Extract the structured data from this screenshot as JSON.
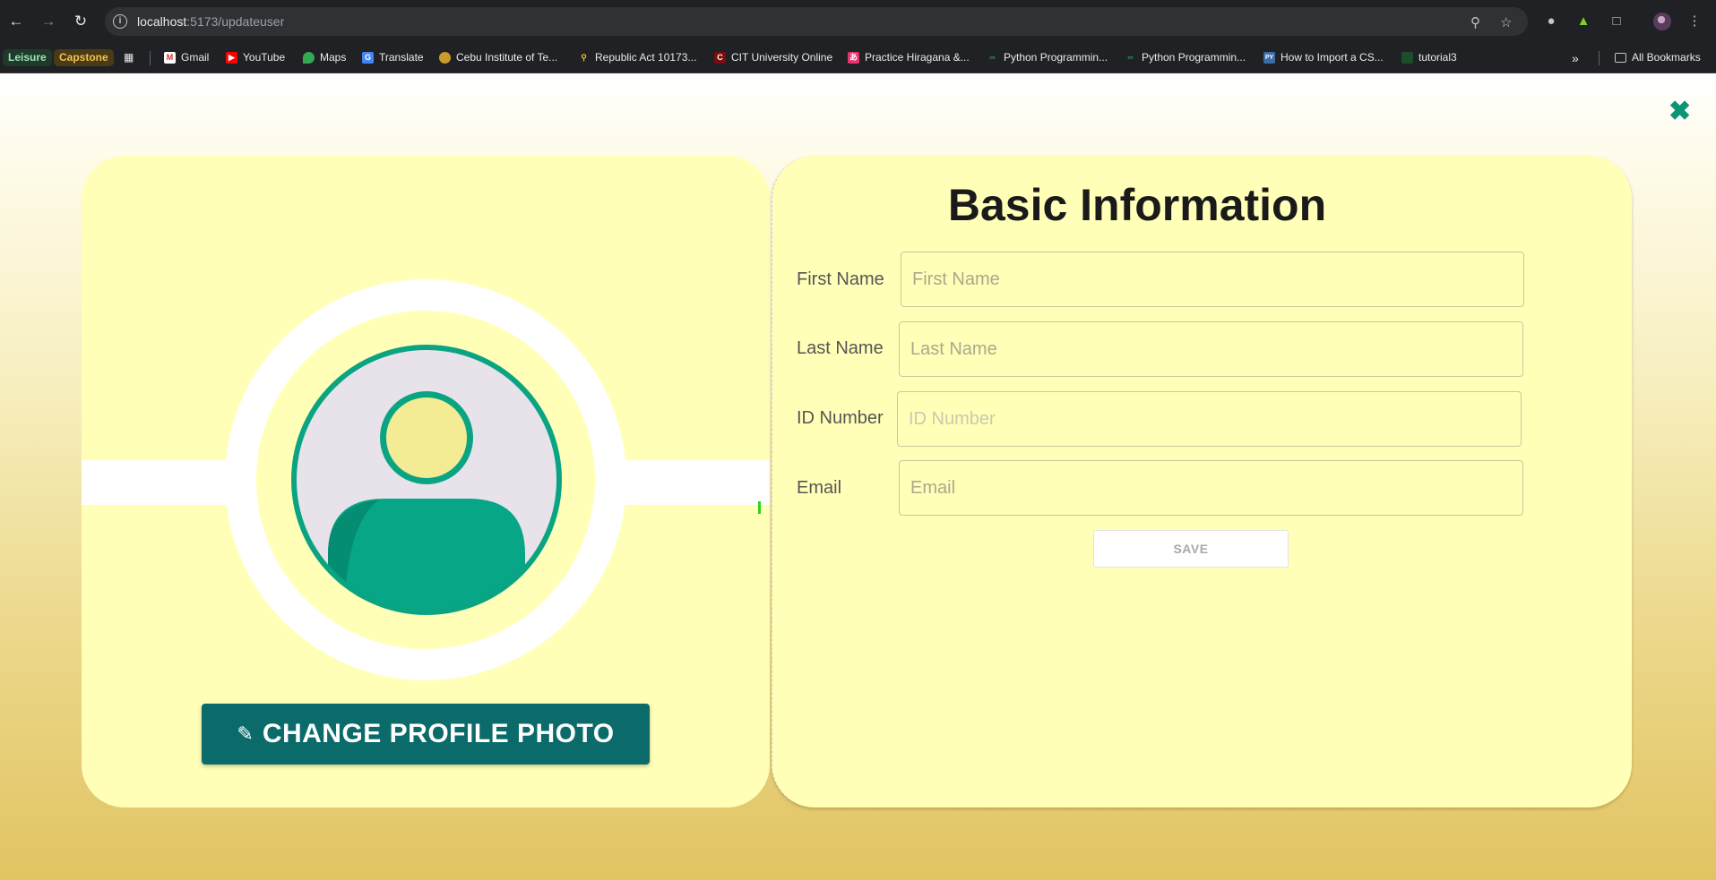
{
  "browser": {
    "url_host": "localhost",
    "url_path": ":5173/updateuser",
    "bookmarks": [
      {
        "label": "Leisure",
        "color": "#9ae6b4"
      },
      {
        "label": "Capstone",
        "color": "#f2c14e"
      },
      {
        "label": "Gmail",
        "icon": "gmail-icon"
      },
      {
        "label": "YouTube",
        "icon": "youtube-icon"
      },
      {
        "label": "Maps",
        "icon": "maps-icon"
      },
      {
        "label": "Translate",
        "icon": "translate-icon"
      },
      {
        "label": "Cebu Institute of Te...",
        "icon": "cit-icon"
      },
      {
        "label": "Republic Act 10173...",
        "icon": "pin-icon"
      },
      {
        "label": "CIT University Online",
        "icon": "cit-u-icon"
      },
      {
        "label": "Practice Hiragana &...",
        "icon": "hiragana-icon"
      },
      {
        "label": "Python Programmin...",
        "icon": "gfg-icon"
      },
      {
        "label": "Python Programmin...",
        "icon": "gfg-icon"
      },
      {
        "label": "How to Import a CS...",
        "icon": "py-icon"
      },
      {
        "label": "tutorial3",
        "icon": "tutorial-icon"
      }
    ],
    "all_bookmarks": "All Bookmarks"
  },
  "page": {
    "close_symbol": "✖",
    "profile": {
      "change_photo_label": "CHANGE PROFILE PHOTO",
      "avatar_colors": {
        "ring": "#0ba483",
        "face": "#f3ec95",
        "body": "#07a686",
        "bg": "#e8e3eb"
      }
    },
    "form": {
      "title": "Basic Information",
      "fields": [
        {
          "label": "First Name",
          "placeholder": "First Name"
        },
        {
          "label": "Last Name",
          "placeholder": "Last Name"
        },
        {
          "label": "ID Number",
          "placeholder": "ID Number"
        },
        {
          "label": "Email",
          "placeholder": "Email"
        }
      ],
      "save_label": "SAVE"
    }
  }
}
